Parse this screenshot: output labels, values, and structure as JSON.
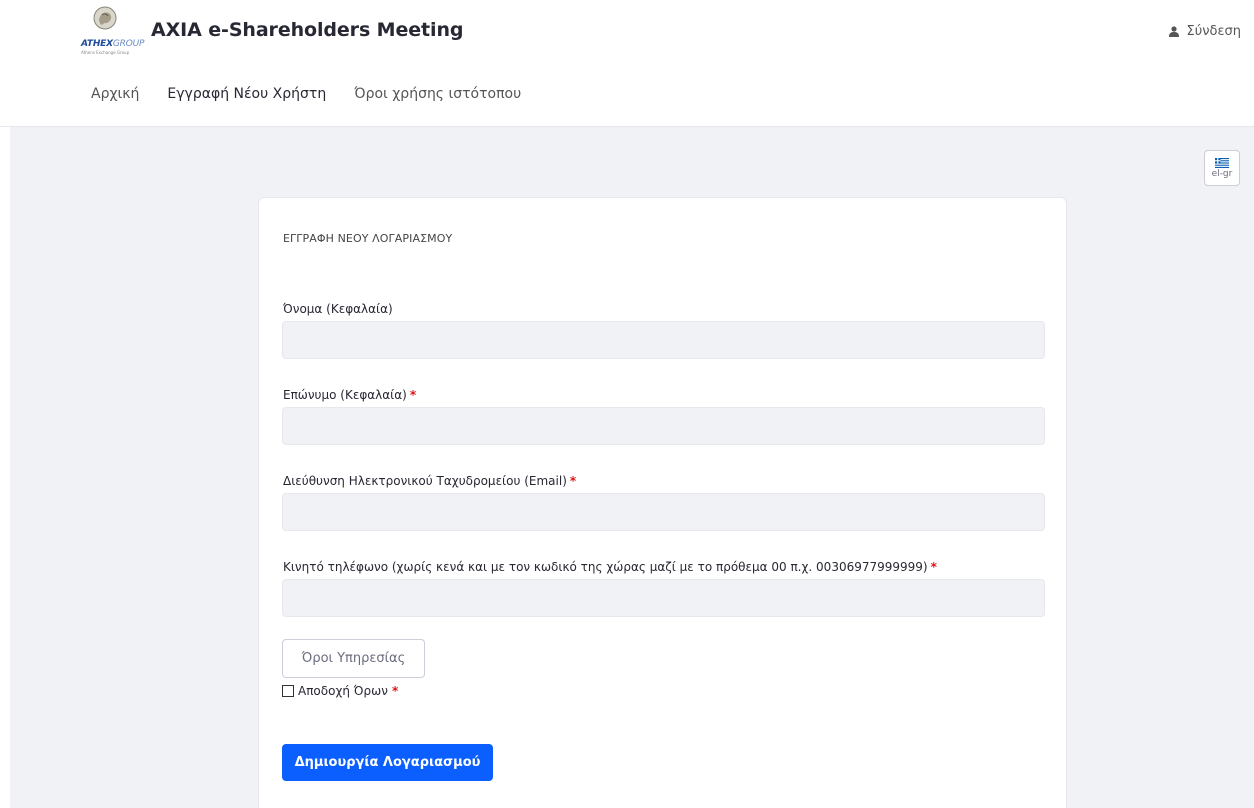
{
  "header": {
    "logo": {
      "word_bold": "ATHEX",
      "word_light": "GROUP",
      "sub": "Athens Exchange Group"
    },
    "site_title": "AXIA e-Shareholders Meeting",
    "login_label": "Σύνδεση",
    "login_icon": "user-icon"
  },
  "nav": {
    "items": [
      {
        "label": "Αρχική",
        "active": false
      },
      {
        "label": "Εγγραφή Νέου Χρήστη",
        "active": true
      },
      {
        "label": "Όροι χρήσης ιστότοπου",
        "active": false
      }
    ]
  },
  "language": {
    "code": "el-gr",
    "flag_icon": "greek-flag-icon"
  },
  "form": {
    "title": "ΕΓΓΡΑΦΗ ΝΕΟΥ ΛΟΓΑΡΙΑΣΜΟΥ",
    "required_mark": "*",
    "fields": [
      {
        "label": "Όνομα (Κεφαλαία)",
        "required": false,
        "value": ""
      },
      {
        "label": "Επώνυμο (Κεφαλαία)",
        "required": true,
        "value": ""
      },
      {
        "label": "Διεύθυνση Ηλεκτρονικού Ταχυδρομείου (Email)",
        "required": true,
        "value": ""
      },
      {
        "label": "Κινητό τηλέφωνο (χωρίς κενά και με τον κωδικό της χώρας μαζί με το πρόθεμα 00 π.χ. 00306977999999)",
        "required": true,
        "value": ""
      }
    ],
    "terms_button": "Όροι Υπηρεσίας",
    "accept_label": "Αποδοχή Όρων",
    "accept_checked": false,
    "submit_button": "Δημιουργία Λογαριασμού"
  },
  "colors": {
    "primary": "#0b5fff",
    "required": "#da1414",
    "page_bg": "#f1f2f5",
    "input_bg": "#f1f2f5"
  }
}
